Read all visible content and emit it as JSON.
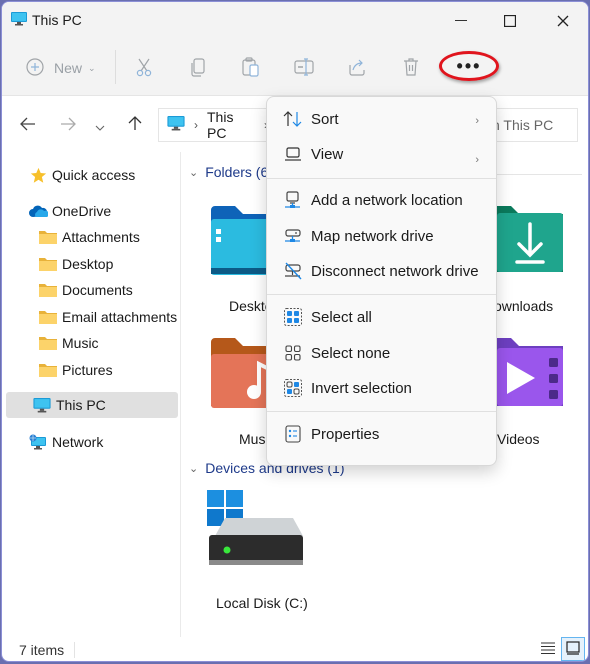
{
  "window": {
    "title": "This PC"
  },
  "toolbar": {
    "new_label": "New",
    "more_label": "•••"
  },
  "navigation": {
    "breadcrumb": [
      "This PC"
    ],
    "search_placeholder": "Search This PC",
    "search_visible_text": "h This PC"
  },
  "sidebar": {
    "items": [
      {
        "label": "Quick access",
        "icon": "star-icon"
      },
      {
        "label": "OneDrive",
        "icon": "onedrive-cloud-icon"
      },
      {
        "label": "Attachments",
        "icon": "folder-icon"
      },
      {
        "label": "Desktop",
        "icon": "folder-icon"
      },
      {
        "label": "Documents",
        "icon": "folder-icon"
      },
      {
        "label": "Email attachments",
        "icon": "folder-icon"
      },
      {
        "label": "Music",
        "icon": "folder-icon"
      },
      {
        "label": "Pictures",
        "icon": "folder-icon"
      },
      {
        "label": "This PC",
        "icon": "monitor-icon",
        "selected": true
      },
      {
        "label": "Network",
        "icon": "network-icon"
      }
    ]
  },
  "content": {
    "folders_header": "Folders (6)",
    "folders": [
      {
        "label": "Desktop",
        "visible": "Deskto"
      },
      {
        "label": "Downloads",
        "visible": "ownloads"
      },
      {
        "label": "Music",
        "visible": "Musi"
      },
      {
        "label": "Videos",
        "visible": "Videos"
      }
    ],
    "devices_header": "Devices and drives (1)",
    "drives": [
      {
        "label": "Local Disk (C:)"
      }
    ]
  },
  "context_menu": {
    "items": [
      {
        "label": "Sort",
        "icon": "sort-icon",
        "submenu": true
      },
      {
        "label": "View",
        "icon": "view-icon",
        "submenu": true
      },
      {
        "label": "Add a network location",
        "icon": "add-network-location-icon"
      },
      {
        "label": "Map network drive",
        "icon": "map-network-drive-icon"
      },
      {
        "label": "Disconnect network drive",
        "icon": "disconnect-network-drive-icon"
      },
      {
        "label": "Select all",
        "icon": "select-all-icon"
      },
      {
        "label": "Select none",
        "icon": "select-none-icon"
      },
      {
        "label": "Invert selection",
        "icon": "invert-selection-icon"
      },
      {
        "label": "Properties",
        "icon": "properties-icon"
      }
    ],
    "submenu_arrow": "›"
  },
  "statusbar": {
    "item_count": "7 items"
  },
  "colors": {
    "accent": "#0067c0",
    "highlight_ring": "#e0141d",
    "selected_bg": "#e0e0e0"
  }
}
